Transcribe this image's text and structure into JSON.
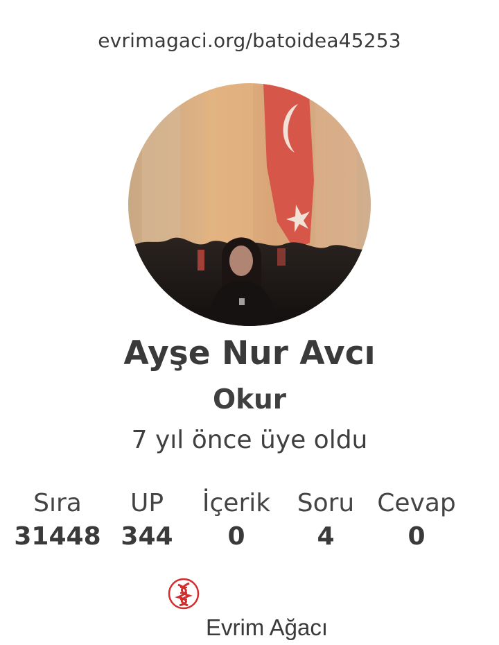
{
  "page": {
    "url_text": "evrimagaci.org/batoidea45253"
  },
  "profile": {
    "name": "Ayşe Nur Avcı",
    "role": "Okur",
    "member_since": "7 yıl önce üye oldu",
    "avatar_icon": "profile-photo"
  },
  "stats": [
    {
      "label": "Sıra",
      "value": "31448"
    },
    {
      "label": "UP",
      "value": "344"
    },
    {
      "label": "İçerik",
      "value": "0"
    },
    {
      "label": "Soru",
      "value": "4"
    },
    {
      "label": "Cevap",
      "value": "0"
    }
  ],
  "brand": {
    "name": "Evrim Ağacı",
    "logo_icon": "dna-helix-icon",
    "logo_color": "#d42b2b"
  },
  "colors": {
    "text": "#3a3a3a",
    "background": "#ffffff",
    "accent": "#d42b2b"
  }
}
